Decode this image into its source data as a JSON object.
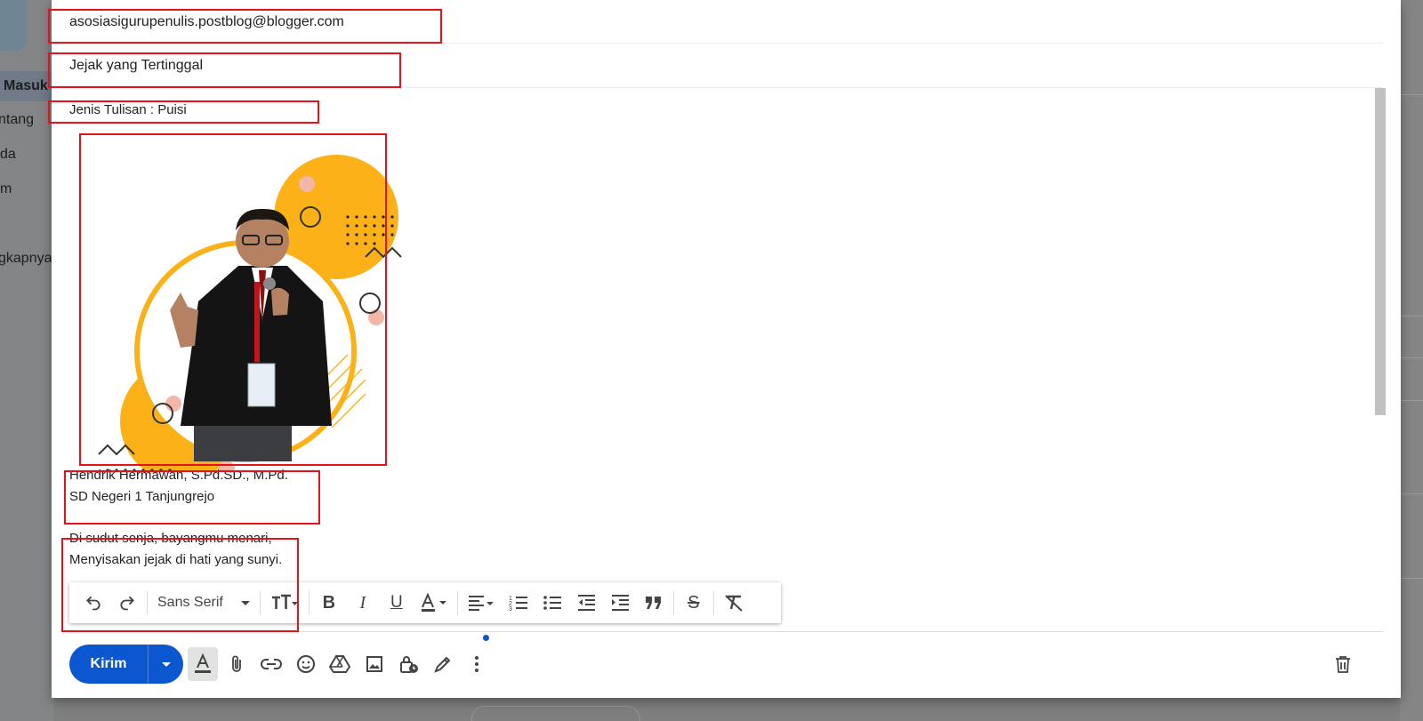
{
  "background_nav": {
    "items": [
      {
        "label": "Masuk",
        "active": true
      },
      {
        "label": "ntang",
        "active": false
      },
      {
        "label": "da",
        "active": false
      },
      {
        "label": "m",
        "active": false
      },
      {
        "label": "gkapnya",
        "active": false
      }
    ]
  },
  "compose": {
    "to_value": "asosiasigurupenulis.postblog@blogger.com",
    "subject_value": "Jejak yang Tertinggal",
    "body": {
      "genre_line": "Jenis Tulisan : Puisi",
      "author_name": "Hendrik Hermawan, S.Pd.SD., M.Pd.",
      "author_school": "SD Negeri 1 Tanjungrejo",
      "poem_line_1": "Di sudut senja, bayangmu menari,",
      "poem_line_2": "Menyisakan jejak di hati yang sunyi."
    },
    "format_toolbar": {
      "font_family": "Sans Serif",
      "icons": [
        "undo-icon",
        "redo-icon",
        "text-size-icon",
        "bold-icon",
        "italic-icon",
        "underline-icon",
        "text-color-icon",
        "align-icon",
        "numbered-list-icon",
        "bulleted-list-icon",
        "indent-less-icon",
        "indent-more-icon",
        "quote-icon",
        "strikethrough-icon",
        "remove-formatting-icon"
      ]
    },
    "send_label": "Kirim",
    "bottom_icons": [
      "formatting-options-icon",
      "attach-icon",
      "link-icon",
      "emoji-icon",
      "drive-icon",
      "image-icon",
      "confidential-icon",
      "signature-icon",
      "more-options-icon",
      "discard-icon"
    ]
  },
  "colors": {
    "send_button": "#0b57d0",
    "highlight_box": "#e3121b",
    "illustration_accent": "#fbb117"
  }
}
